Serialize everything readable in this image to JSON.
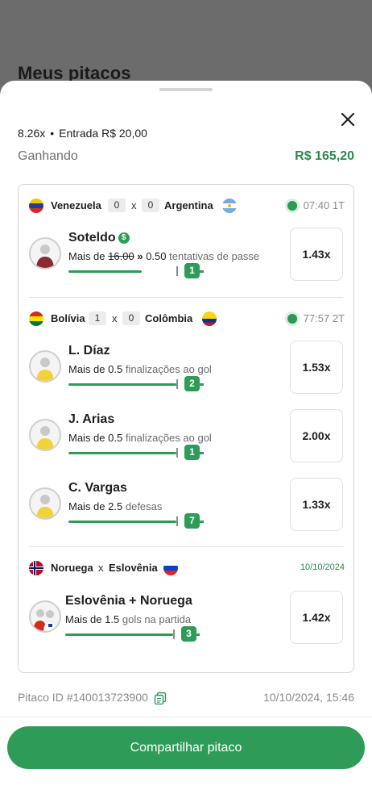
{
  "page": {
    "title": "Meus pitacos"
  },
  "sheet": {
    "multiplier": "8.26x",
    "bullet": "•",
    "entry": "Entrada R$ 20,00",
    "status_label": "Ganhando",
    "status_value": "R$ 165,20"
  },
  "matches": [
    {
      "home": "Venezuela",
      "home_score": "0",
      "vs": "x",
      "away_score": "0",
      "away": "Argentina",
      "time": "07:40 1T",
      "picks": [
        {
          "player": "Soteldo",
          "prefix": "Mais de",
          "old_line": "16.00",
          "arrows": "»",
          "line": "0.50",
          "stat": "tentativas de passe",
          "progress_badge": "1",
          "odds": "1.43x",
          "progress": 0.68
        }
      ]
    },
    {
      "home": "Bolívia",
      "home_score": "1",
      "vs": "x",
      "away_score": "0",
      "away": "Colômbia",
      "time": "77:57 2T",
      "picks": [
        {
          "player": "L. Díaz",
          "prefix": "Mais de",
          "line": "0.5",
          "stat": "finalizações ao gol",
          "progress_badge": "2",
          "odds": "1.53x",
          "progress": 1.0
        },
        {
          "player": "J. Arias",
          "prefix": "Mais de",
          "line": "0.5",
          "stat": "finalizações ao gol",
          "progress_badge": "1",
          "odds": "2.00x",
          "progress": 1.0
        },
        {
          "player": "C. Vargas",
          "prefix": "Mais de",
          "line": "2.5",
          "stat": "defesas",
          "progress_badge": "7",
          "odds": "1.33x",
          "progress": 1.0
        }
      ]
    },
    {
      "home": "Noruega",
      "vs": "x",
      "away": "Eslovênia",
      "date": "10/10/2024",
      "picks": [
        {
          "player": "Eslovênia + Noruega",
          "prefix": "Mais de",
          "line": "1.5",
          "stat": "gols na partida",
          "progress_badge": "3",
          "odds": "1.42x",
          "progress": 1.0
        }
      ]
    }
  ],
  "footer": {
    "pitaco_id": "Pitaco ID #140013723900",
    "datetime": "10/10/2024, 15:46",
    "share_label": "Compartilhar pitaco"
  },
  "icons": {
    "close": "close-icon",
    "copy": "copy-icon",
    "cash": "dollar-icon",
    "live": "live-dot-icon"
  },
  "colors": {
    "accent": "#2e9c58",
    "accent_text": "#2a8a4c",
    "muted": "#8a8a8a"
  }
}
